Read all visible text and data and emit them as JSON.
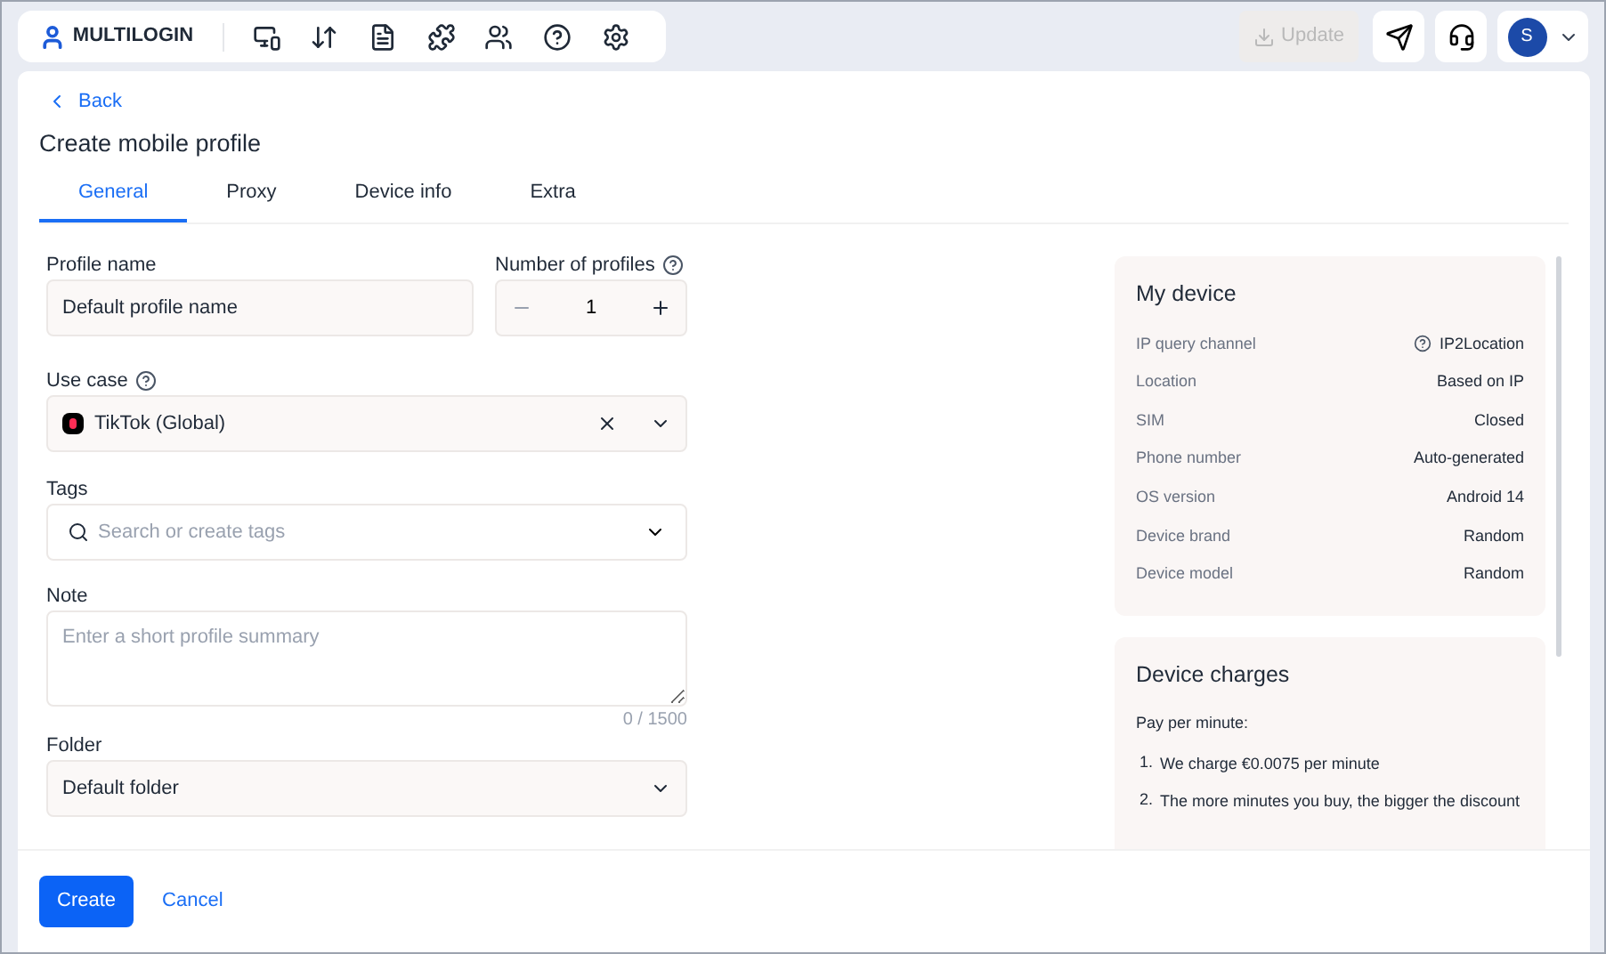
{
  "header": {
    "logo": "MULTILOGIN",
    "update_button": {
      "label": "Update",
      "disabled": true
    },
    "avatar": "S"
  },
  "back_link": "Back",
  "title": "Create mobile profile",
  "tabs": [
    {
      "label": "General",
      "selected": true
    },
    {
      "label": "Proxy",
      "selected": false
    },
    {
      "label": "Device info",
      "selected": false
    },
    {
      "label": "Extra",
      "selected": false
    }
  ],
  "form": {
    "profile_name": {
      "label": "Profile name",
      "value": "Default profile name"
    },
    "number_of_profiles": {
      "label": "Number of profiles",
      "value": "1"
    },
    "use_case": {
      "label": "Use case",
      "value": "TikTok (Global)"
    },
    "tags": {
      "label": "Tags",
      "placeholder": "Search or create tags"
    },
    "note": {
      "label": "Note",
      "placeholder": "Enter a short profile summary",
      "counter": "0 / 1500"
    },
    "folder": {
      "label": "Folder",
      "value": "Default folder"
    }
  },
  "my_device": {
    "title": "My device",
    "rows": [
      {
        "label": "IP query channel",
        "value": "IP2Location",
        "help": true
      },
      {
        "label": "Location",
        "value": "Based on IP",
        "help": false
      },
      {
        "label": "SIM",
        "value": "Closed",
        "help": false
      },
      {
        "label": "Phone number",
        "value": "Auto-generated",
        "help": false
      },
      {
        "label": "OS version",
        "value": "Android 14",
        "help": false
      },
      {
        "label": "Device brand",
        "value": "Random",
        "help": false
      },
      {
        "label": "Device model",
        "value": "Random",
        "help": false
      }
    ]
  },
  "device_charges": {
    "title": "Device charges",
    "intro": "Pay per minute:",
    "items": [
      {
        "number": "1.",
        "text": "We charge €0.0075 per minute"
      },
      {
        "number": "2.",
        "text": "The more minutes you buy, the bigger the discount"
      }
    ]
  },
  "footer": {
    "create": "Create",
    "cancel": "Cancel"
  }
}
